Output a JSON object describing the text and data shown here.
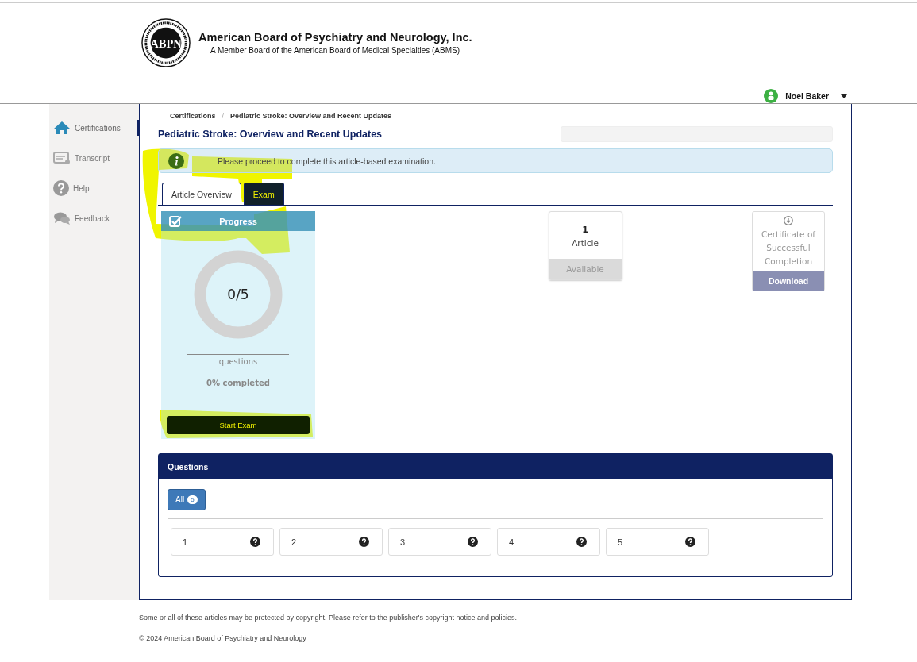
{
  "header": {
    "logo_letters": "ABPN",
    "title": "American Board of Psychiatry and Neurology, Inc.",
    "subtitle": "A Member Board of the American Board of Medical Specialties (ABMS)",
    "user": "Noel Baker"
  },
  "sidebar": {
    "items": [
      {
        "label": "Certifications",
        "kind": "home",
        "selected": true
      },
      {
        "label": "Transcript",
        "kind": "transcript",
        "selected": false
      },
      {
        "label": "Help",
        "kind": "help",
        "selected": false
      },
      {
        "label": "Feedback",
        "kind": "chat",
        "selected": false
      }
    ]
  },
  "breadcrumb": {
    "items": [
      "Certifications",
      "Pediatric Stroke: Overview and Recent Updates"
    ],
    "separator": "/"
  },
  "page_title": "Pediatric Stroke: Overview and Recent Updates",
  "alert": "Please proceed to complete this article-based examination.",
  "tabs": [
    {
      "label": "Article Overview",
      "selected": false
    },
    {
      "label": "Exam",
      "selected": true
    }
  ],
  "progress": {
    "title": "Progress",
    "reading": "0/5",
    "unit": "questions",
    "completed": "0% completed",
    "button": "Start Exam"
  },
  "article_card": {
    "count": "1",
    "label": "Article",
    "status": "Available"
  },
  "certificate_card": {
    "label": "Certificate of Successful Completion",
    "button": "Download"
  },
  "questions": {
    "title": "Questions",
    "filter": {
      "label": "All",
      "count": "5"
    },
    "items": [
      "1",
      "2",
      "3",
      "4",
      "5"
    ]
  },
  "footer": {
    "notice": "Some or all of these articles may be protected by copyright.  Please refer to the publisher's copyright notice and policies.",
    "copyright": "© 2024 American Board of Psychiatry and Neurology"
  }
}
